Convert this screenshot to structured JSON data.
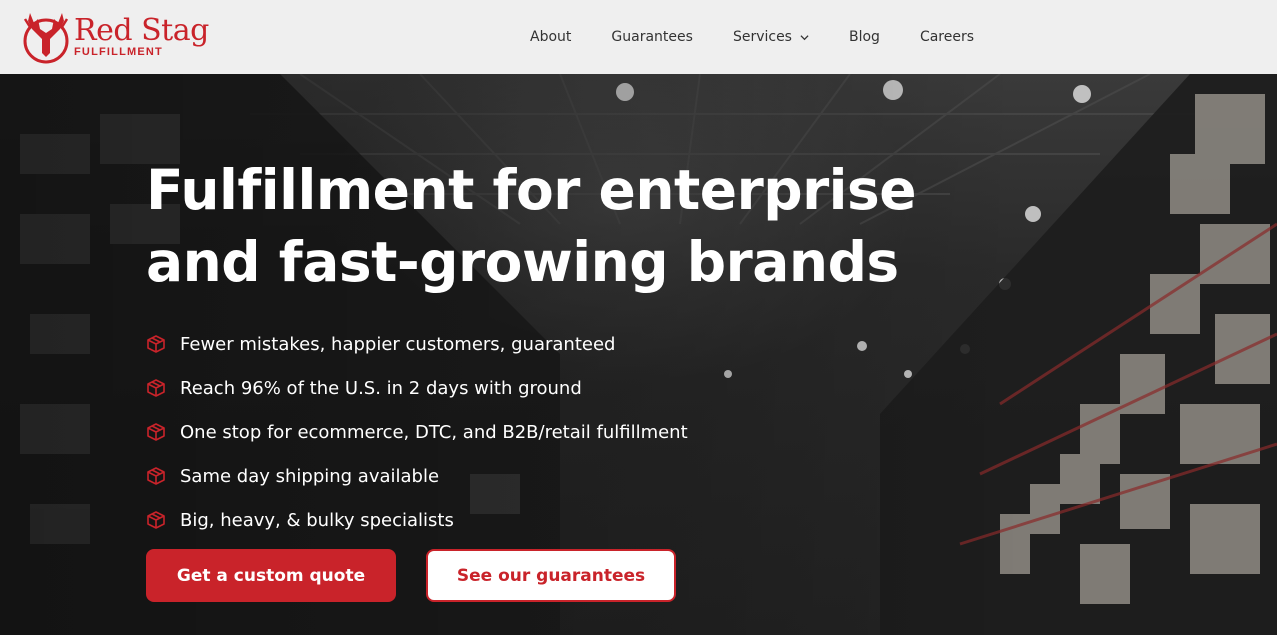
{
  "brand": {
    "name": "Red Stag",
    "sub": "FULFILLMENT",
    "color": "#c9232a"
  },
  "nav": {
    "items": [
      {
        "label": "About"
      },
      {
        "label": "Guarantees"
      },
      {
        "label": "Services",
        "has_dropdown": true
      },
      {
        "label": "Blog"
      },
      {
        "label": "Careers"
      }
    ]
  },
  "hero": {
    "headline_line1": "Fulfillment for enterprise",
    "headline_line2": "and fast-growing brands",
    "bullet_icon": "package-box-icon",
    "bullets": [
      "Fewer mistakes, happier customers, guaranteed",
      "Reach 96% of the U.S. in 2 days with ground",
      "One stop for ecommerce, DTC, and B2B/retail fulfillment",
      "Same day shipping available",
      "Big, heavy, & bulky specialists"
    ],
    "primary_cta": "Get a custom quote",
    "secondary_cta": "See our guarantees"
  }
}
